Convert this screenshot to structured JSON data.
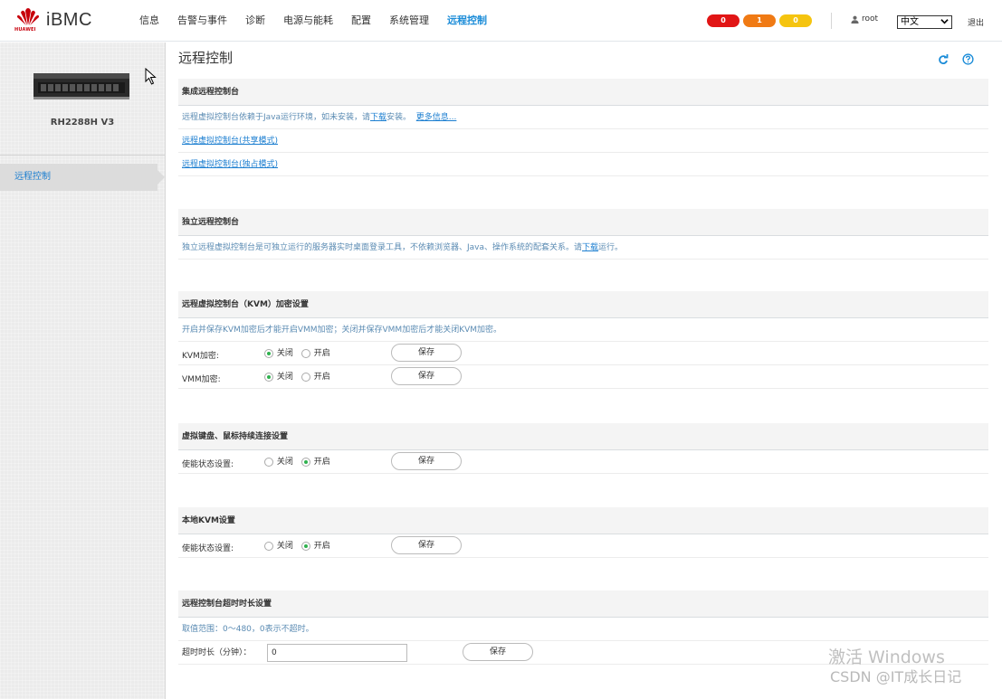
{
  "header": {
    "brand_small": "HUAWEI",
    "brand": "iBMC",
    "nav": [
      "信息",
      "告警与事件",
      "诊断",
      "电源与能耗",
      "配置",
      "系统管理",
      "远程控制"
    ],
    "active_nav": 6,
    "alarms": {
      "critical": "0",
      "major": "1",
      "minor": "0"
    },
    "user": "root",
    "language": "中文",
    "logout": "退出"
  },
  "sidebar": {
    "server_model": "RH2288H V3",
    "items": [
      {
        "label": "远程控制"
      }
    ]
  },
  "page": {
    "title": "远程控制",
    "sections": {
      "integrated": {
        "title": "集成远程控制台",
        "info_prefix": "远程虚拟控制台依赖于Java运行环境，如未安装，请",
        "info_link": "下载",
        "info_suffix": "安装。",
        "more_link": "更多信息...",
        "shared_link": "远程虚拟控制台(共享模式)",
        "exclusive_link": "远程虚拟控制台(独占模式)"
      },
      "standalone": {
        "title": "独立远程控制台",
        "info_prefix": "独立远程虚拟控制台是可独立运行的服务器实时桌面登录工具，不依赖浏览器、Java、操作系统的配套关系。请",
        "info_link": "下载",
        "info_suffix": "运行。"
      },
      "kvm_encrypt": {
        "title": "远程虚拟控制台（KVM）加密设置",
        "info": "开启并保存KVM加密后才能开启VMM加密；关闭并保存VMM加密后才能关闭KVM加密。",
        "kvm_label": "KVM加密:",
        "vmm_label": "VMM加密:",
        "off": "关闭",
        "on": "开启",
        "save": "保存"
      },
      "keyboard_mouse": {
        "title": "虚拟键盘、鼠标持续连接设置",
        "label": "使能状态设置:",
        "off": "关闭",
        "on": "开启",
        "save": "保存"
      },
      "local_kvm": {
        "title": "本地KVM设置",
        "label": "使能状态设置:",
        "off": "关闭",
        "on": "开启",
        "save": "保存"
      },
      "timeout": {
        "title": "远程控制台超时时长设置",
        "info": "取值范围：0～480，0表示不超时。",
        "label": "超时时长（分钟）：",
        "value": "0",
        "save": "保存"
      }
    }
  },
  "watermark": {
    "activate": "激活 Windows",
    "credit": "CSDN @IT成长日记"
  },
  "colors": {
    "accent": "#1b8cd8",
    "alarm_critical": "#e11515",
    "alarm_major": "#f07a14",
    "alarm_minor": "#f5c40f",
    "radio_on": "#2fb24e"
  }
}
